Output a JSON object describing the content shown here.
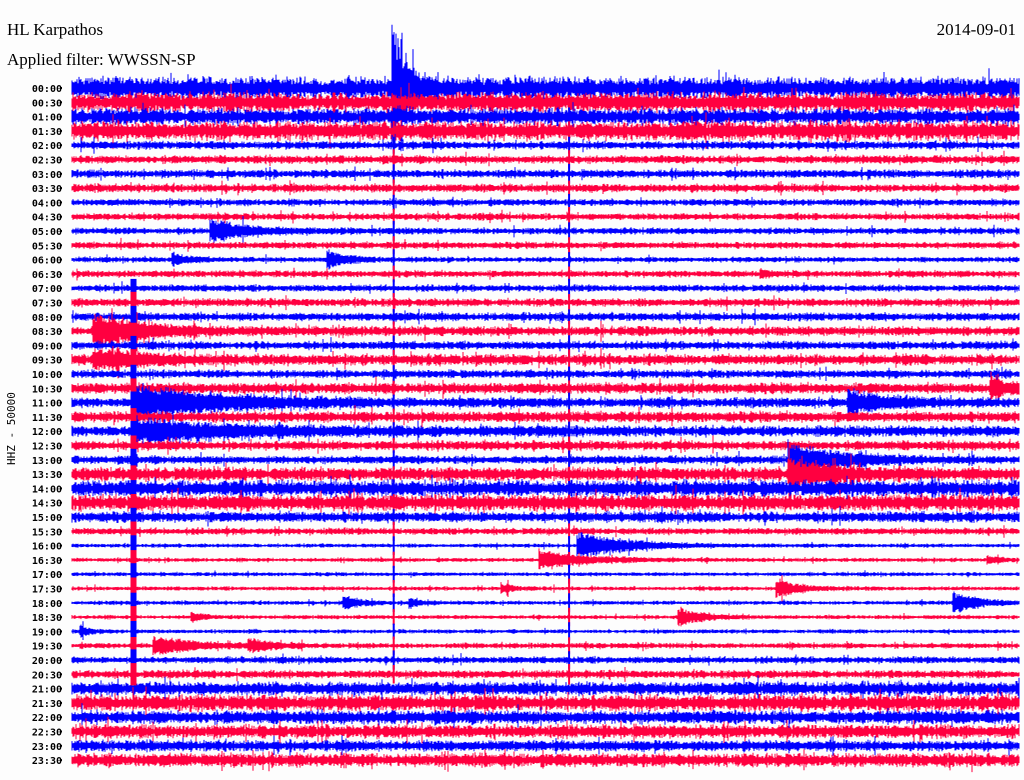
{
  "header": {
    "station": "HL Karpathos",
    "filter": "Applied filter: WWSSN-SP",
    "date": "2014-09-01"
  },
  "chart_data": {
    "type": "line",
    "title": "HL Karpathos",
    "subtitle": "Applied filter: WWSSN-SP",
    "date": "2014-09-01",
    "ylabel": "HHZ - 50000",
    "xlabel": "",
    "minutes_per_row": 30,
    "colors": [
      "#0000ff",
      "#ff0040"
    ],
    "rows": [
      "00:00",
      "00:30",
      "01:00",
      "01:30",
      "02:00",
      "02:30",
      "03:00",
      "03:30",
      "04:00",
      "04:30",
      "05:00",
      "05:30",
      "06:00",
      "06:30",
      "07:00",
      "07:30",
      "08:00",
      "08:30",
      "09:00",
      "09:30",
      "10:00",
      "10:30",
      "11:00",
      "11:30",
      "12:00",
      "12:30",
      "13:00",
      "13:30",
      "14:00",
      "14:30",
      "15:00",
      "15:30",
      "16:00",
      "16:30",
      "17:00",
      "17:30",
      "18:00",
      "18:30",
      "19:00",
      "19:30",
      "20:00",
      "20:30",
      "21:00",
      "21:30",
      "22:00",
      "22:30",
      "23:00",
      "23:30"
    ],
    "noise_level": [
      8,
      7,
      6,
      7,
      3,
      3,
      3,
      3,
      2.5,
      2.5,
      2.5,
      2.5,
      2,
      2.5,
      2.5,
      3,
      3,
      3.5,
      3,
      4,
      3,
      4,
      3.5,
      4,
      4,
      3.5,
      3,
      5,
      6,
      6,
      4,
      2.5,
      1.5,
      1.5,
      1.5,
      1.5,
      1.5,
      1.5,
      1.5,
      2,
      2.5,
      3,
      5,
      6,
      5,
      5,
      4,
      5
    ],
    "pulses": [
      {
        "minute": 10.15,
        "rows": [
          0,
          41
        ],
        "amplitude": 8,
        "color": "#ff0040"
      },
      {
        "minute": 15.7,
        "rows": [
          0,
          41
        ],
        "amplitude": 8,
        "color": "#0000ff"
      },
      {
        "minute": 1.85,
        "rows": [
          14,
          41
        ],
        "amplitude": 9,
        "color": "#0000ff"
      }
    ],
    "events": [
      {
        "row": 0,
        "minute": 10.15,
        "amplitude": 60,
        "decay": 0.4
      },
      {
        "row": 17,
        "minute": 0.7,
        "amplitude": 14,
        "decay": 1.5
      },
      {
        "row": 19,
        "minute": 0.7,
        "amplitude": 8,
        "decay": 1.5
      },
      {
        "row": 10,
        "minute": 4.4,
        "amplitude": 10,
        "decay": 1.0
      },
      {
        "row": 12,
        "minute": 3.2,
        "amplitude": 6,
        "decay": 0.5
      },
      {
        "row": 12,
        "minute": 8.1,
        "amplitude": 7,
        "decay": 0.6
      },
      {
        "row": 22,
        "minute": 1.9,
        "amplitude": 14,
        "decay": 3
      },
      {
        "row": 24,
        "minute": 1.9,
        "amplitude": 10,
        "decay": 3
      },
      {
        "row": 26,
        "minute": 22.7,
        "amplitude": 14,
        "decay": 1.5
      },
      {
        "row": 27,
        "minute": 22.7,
        "amplitude": 10,
        "decay": 1.5
      },
      {
        "row": 22,
        "minute": 24.6,
        "amplitude": 10,
        "decay": 1.2
      },
      {
        "row": 21,
        "minute": 29.1,
        "amplitude": 6,
        "decay": 0.8
      },
      {
        "row": 32,
        "minute": 16.0,
        "amplitude": 12,
        "decay": 1.5
      },
      {
        "row": 33,
        "minute": 14.8,
        "amplitude": 8,
        "decay": 1.5
      },
      {
        "row": 33,
        "minute": 29.0,
        "amplitude": 3,
        "decay": 0.4
      },
      {
        "row": 35,
        "minute": 13.6,
        "amplitude": 4,
        "decay": 0.4
      },
      {
        "row": 35,
        "minute": 22.3,
        "amplitude": 8,
        "decay": 0.7
      },
      {
        "row": 36,
        "minute": 27.9,
        "amplitude": 9,
        "decay": 0.8
      },
      {
        "row": 36,
        "minute": 8.6,
        "amplitude": 6,
        "decay": 0.5
      },
      {
        "row": 36,
        "minute": 10.7,
        "amplitude": 4,
        "decay": 0.4
      },
      {
        "row": 37,
        "minute": 19.2,
        "amplitude": 8,
        "decay": 0.7
      },
      {
        "row": 37,
        "minute": 3.8,
        "amplitude": 4,
        "decay": 0.4
      },
      {
        "row": 38,
        "minute": 0.3,
        "amplitude": 4,
        "decay": 0.4
      },
      {
        "row": 39,
        "minute": 2.6,
        "amplitude": 8,
        "decay": 1.2
      },
      {
        "row": 39,
        "minute": 5.6,
        "amplitude": 6,
        "decay": 0.6
      },
      {
        "row": 13,
        "minute": 21.8,
        "amplitude": 3,
        "decay": 0.4
      }
    ]
  }
}
